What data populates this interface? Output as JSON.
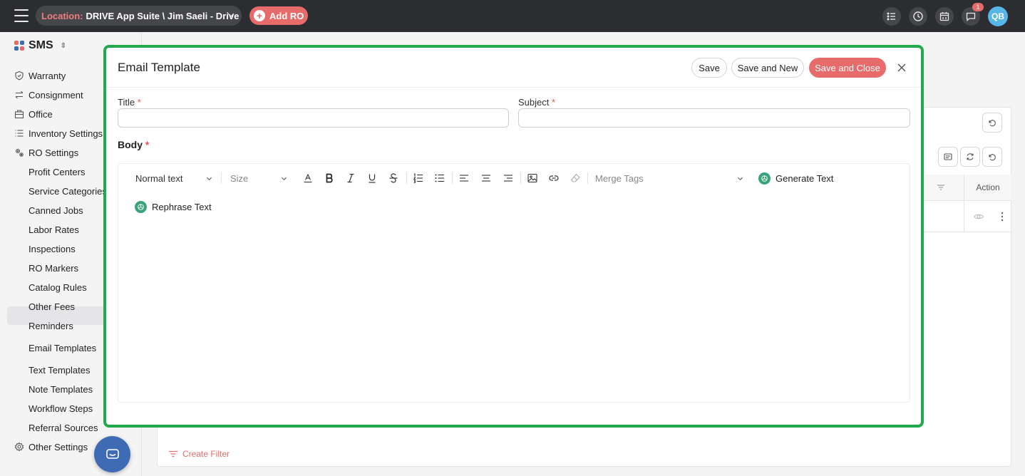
{
  "topbar": {
    "location_label": "Location:",
    "location_value": "DRIVE App Suite \\ Jim Saeli - Drive",
    "add_ro_label": "Add RO",
    "notification_count": "1",
    "avatar_initials": "QB"
  },
  "sidebar": {
    "app_name": "SMS",
    "items": [
      {
        "label": "Warranty",
        "icon": "shield-icon"
      },
      {
        "label": "Consignment",
        "icon": "swap-icon"
      },
      {
        "label": "Office",
        "icon": "building-icon"
      },
      {
        "label": "Inventory Settings",
        "icon": "list-icon"
      },
      {
        "label": "RO Settings",
        "icon": "gears-icon"
      },
      {
        "label": "Profit Centers"
      },
      {
        "label": "Service Categories"
      },
      {
        "label": "Canned Jobs"
      },
      {
        "label": "Labor Rates"
      },
      {
        "label": "Inspections"
      },
      {
        "label": "RO Markers"
      },
      {
        "label": "Catalog Rules"
      },
      {
        "label": "Other Fees"
      },
      {
        "label": "Reminders"
      },
      {
        "label": "Email Templates",
        "active": true
      },
      {
        "label": "Text Templates"
      },
      {
        "label": "Note Templates"
      },
      {
        "label": "Workflow Steps"
      },
      {
        "label": "Referral Sources"
      },
      {
        "label": "Other Settings",
        "icon": "gear-icon"
      }
    ]
  },
  "background": {
    "action_column": "Action",
    "create_filter_label": "Create Filter"
  },
  "modal": {
    "title": "Email Template",
    "save_label": "Save",
    "save_new_label": "Save and New",
    "save_close_label": "Save and Close",
    "title_field": {
      "label": "Title",
      "value": ""
    },
    "subject_field": {
      "label": "Subject",
      "value": ""
    },
    "required_mark": "*",
    "body_label": "Body",
    "toolbar": {
      "text_style": "Normal text",
      "size_placeholder": "Size",
      "merge_tags_placeholder": "Merge Tags",
      "generate_text": "Generate Text",
      "rephrase_text": "Rephrase Text"
    }
  },
  "colors": {
    "accent": "#e86b6b",
    "modal_border": "#22a94b",
    "ai_icon": "#3aa37a",
    "topbar": "#2b2d30"
  }
}
